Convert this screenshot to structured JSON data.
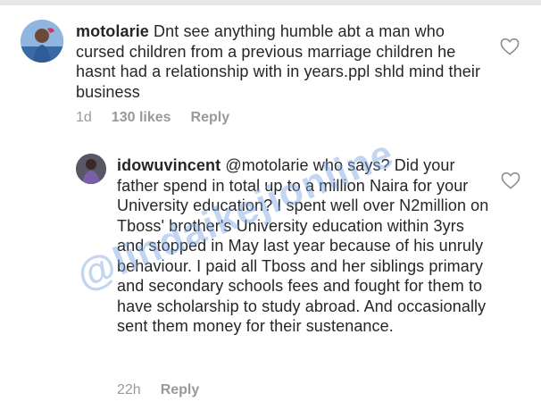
{
  "comments": [
    {
      "username": "motolarie",
      "text": "Dnt see anything humble abt a man who cursed children from a previous marriage children he hasnt had a relationship with in years.ppl shld mind their business",
      "time": "1d",
      "likes": "130 likes",
      "reply_label": "Reply",
      "like_icon": "heart-outline-icon"
    },
    {
      "username": "idowuvincent",
      "text": "@motolarie who says? Did your father spend in total up to a million Naira for your University education? I spent well over N2million on Tboss' brother's University education within 3yrs and stopped in May last year because of his unruly behaviour. I paid all Tboss and her siblings primary and secondary schools fees and fought for them to have scholarship to study abroad. And occasionally sent them money for their sustenance.",
      "time": "22h",
      "reply_label": "Reply",
      "like_icon": "heart-outline-icon"
    }
  ],
  "watermark": "@lindaikejionline",
  "colors": {
    "text": "#262626",
    "meta": "#999999",
    "watermark": "#78a5e1"
  }
}
